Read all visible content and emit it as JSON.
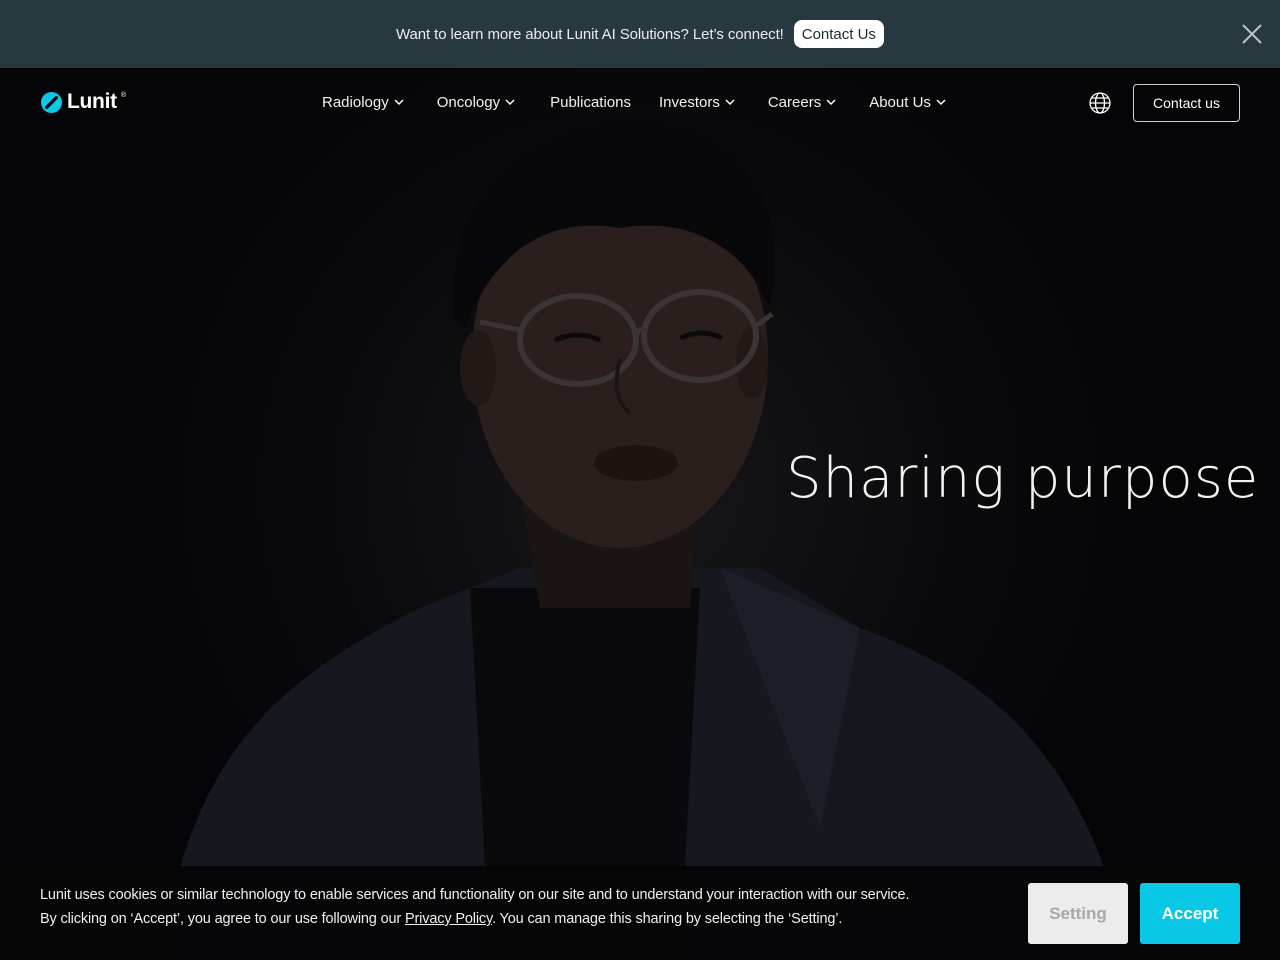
{
  "promo": {
    "text": "Want to learn more about Lunit AI Solutions? Let’s connect!",
    "button_label": "Contact Us",
    "close_icon": "close-icon"
  },
  "header": {
    "logo_text": "Lunit",
    "logo_reg": "®",
    "nav": [
      {
        "label": "Radiology",
        "has_dropdown": true
      },
      {
        "label": "Oncology",
        "has_dropdown": true
      },
      {
        "label": "Publications",
        "has_dropdown": false
      },
      {
        "label": "Investors",
        "has_dropdown": true
      },
      {
        "label": "Careers",
        "has_dropdown": true
      },
      {
        "label": "About Us",
        "has_dropdown": true
      }
    ],
    "language_icon": "globe-icon",
    "contact_label": "Contact us"
  },
  "hero": {
    "caption": "Sharing purpose"
  },
  "cookie": {
    "line1": "Lunit uses cookies or similar technology to enable services and functionality on our site and to understand your interaction with our service.",
    "line2_before": "By clicking on ‘Accept’, you agree to our use following our ",
    "privacy_link": "Privacy Policy",
    "line2_after": ". You can manage this sharing by selecting the ‘Setting’.",
    "setting_label": "Setting",
    "accept_label": "Accept"
  },
  "colors": {
    "banner_bg": "#27383f",
    "accent": "#09c8e6",
    "background": "#000000"
  }
}
